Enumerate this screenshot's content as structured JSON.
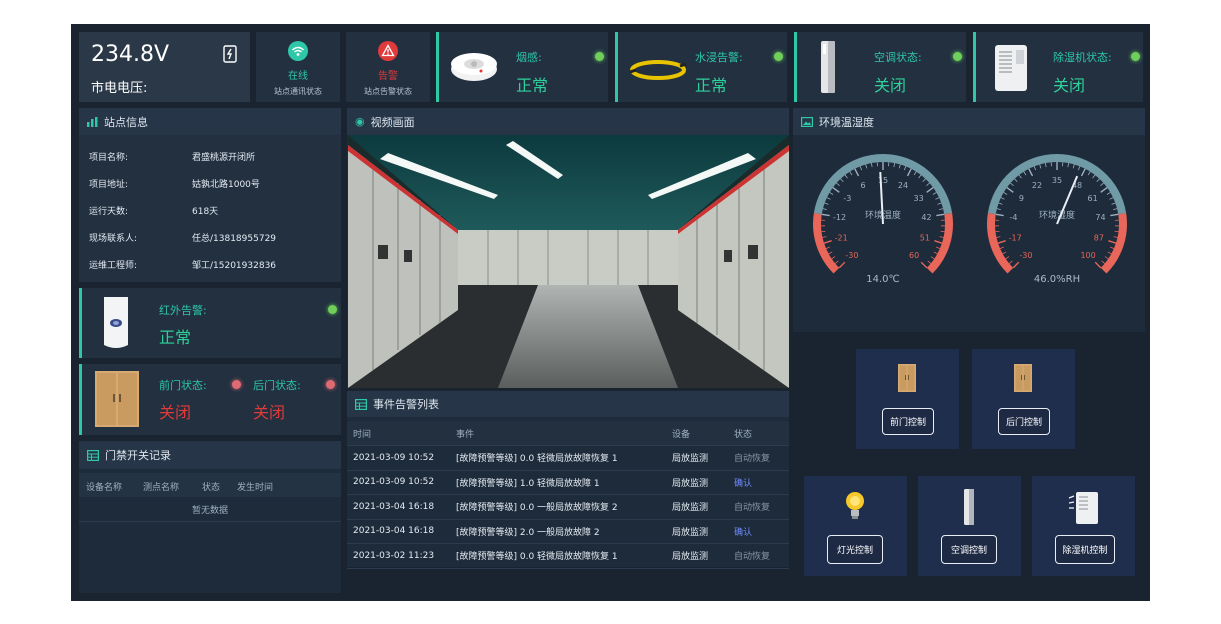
{
  "voltage": {
    "value": "234.8V",
    "label": "市电电压:"
  },
  "comm": {
    "state": "在线",
    "label": "站点通讯状态"
  },
  "alarm": {
    "state": "告警",
    "label": "站点告警状态"
  },
  "status_cards": [
    {
      "label": "烟感:",
      "value": "正常",
      "icon": "smoke-detector-icon"
    },
    {
      "label": "水浸告警:",
      "value": "正常",
      "icon": "water-leak-sensor-icon"
    },
    {
      "label": "空调状态:",
      "value": "关闭",
      "icon": "air-conditioner-icon"
    },
    {
      "label": "除湿机状态:",
      "value": "关闭",
      "icon": "dehumidifier-icon"
    }
  ],
  "station_info": {
    "title": "站点信息",
    "rows": [
      {
        "k": "项目名称:",
        "v": "君盛桃源开闭所"
      },
      {
        "k": "项目地址:",
        "v": "姑孰北路1000号"
      },
      {
        "k": "运行天数:",
        "v": "618天"
      },
      {
        "k": "现场联系人:",
        "v": "任总/13818955729"
      },
      {
        "k": "运维工程师:",
        "v": "邹工/15201932836"
      }
    ]
  },
  "infrared": {
    "label": "红外告警:",
    "value": "正常"
  },
  "doors": {
    "front_label": "前门状态:",
    "front_value": "关闭",
    "back_label": "后门状态:",
    "back_value": "关闭"
  },
  "access_log": {
    "title": "门禁开关记录",
    "cols": [
      "设备名称",
      "测点名称",
      "状态",
      "发生时间"
    ],
    "empty": "暂无数据"
  },
  "video": {
    "title": "视频画面"
  },
  "events": {
    "title": "事件告警列表",
    "cols": [
      "时间",
      "事件",
      "设备",
      "状态"
    ],
    "rows": [
      {
        "t": "2021-03-09 10:52",
        "e": "[故障预警等级] 0.0 轻微局放故障恢复 1",
        "d": "局放监测",
        "s": "自动恢复",
        "link": false
      },
      {
        "t": "2021-03-09 10:52",
        "e": "[故障预警等级] 1.0 轻微局放故障 1",
        "d": "局放监测",
        "s": "确认",
        "link": true
      },
      {
        "t": "2021-03-04 16:18",
        "e": "[故障预警等级] 0.0 一般局放故障恢复 2",
        "d": "局放监测",
        "s": "自动恢复",
        "link": false
      },
      {
        "t": "2021-03-04 16:18",
        "e": "[故障预警等级] 2.0 一般局放故障 2",
        "d": "局放监测",
        "s": "确认",
        "link": true
      },
      {
        "t": "2021-03-02 11:23",
        "e": "[故障预警等级] 0.0 轻微局放故障恢复 1",
        "d": "局放监测",
        "s": "自动恢复",
        "link": false
      }
    ]
  },
  "env": {
    "title": "环境温湿度",
    "temp": {
      "label": "环境温度",
      "value": 14.0,
      "display": "14.0℃",
      "min": -30,
      "max": 60,
      "ticks": [
        "-30",
        "-21",
        "-12",
        "-3",
        "6",
        "15",
        "24",
        "33",
        "42",
        "51",
        "60"
      ]
    },
    "hum": {
      "label": "环境湿度",
      "value": 46.0,
      "display": "46.0%RH",
      "min": -30,
      "max": 100,
      "ticks": [
        "-30",
        "-17",
        "-4",
        "9",
        "22",
        "35",
        "48",
        "61",
        "74",
        "87",
        "100"
      ]
    }
  },
  "controls": {
    "front": "前门控制",
    "back": "后门控制",
    "light": "灯光控制",
    "ac": "空调控制",
    "dehum": "除湿机控制"
  },
  "colors": {
    "accent": "#2ec7a8",
    "alarm": "#e03a3a",
    "ok": "#6fcf5a",
    "panel": "#223040",
    "bg": "#1a2431"
  }
}
